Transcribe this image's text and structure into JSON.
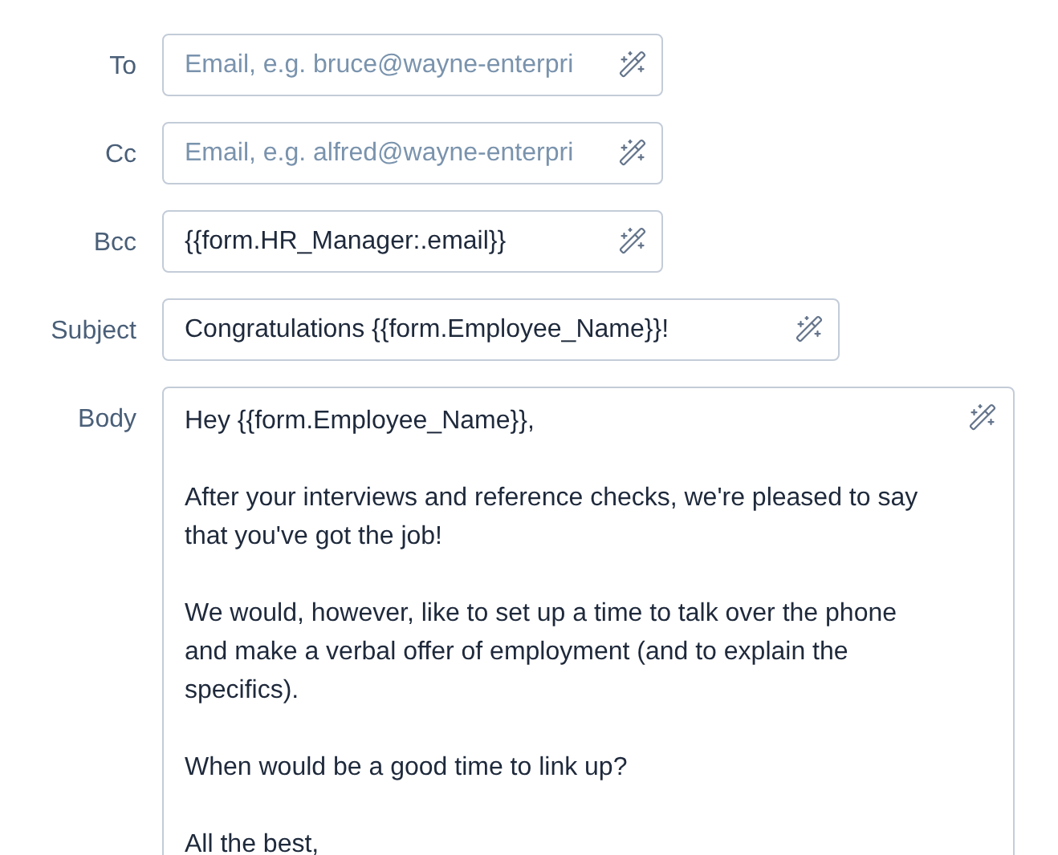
{
  "fields": [
    {
      "kind": "line",
      "label": "To",
      "placeholder": "Email, e.g. bruce@wayne-enterpri",
      "wide": false
    },
    {
      "kind": "line",
      "label": "Cc",
      "placeholder": "Email, e.g. alfred@wayne-enterpri",
      "wide": false
    },
    {
      "kind": "line",
      "label": "Bcc",
      "value": "{{form.HR_Manager:.email}}",
      "wide": false
    },
    {
      "kind": "line",
      "label": "Subject",
      "value": "Congratulations {{form.Employee_Name}}!",
      "wide": true
    },
    {
      "kind": "area",
      "label": "Body",
      "paragraphs": [
        "Hey {{form.Employee_Name}},",
        "After your interviews and reference checks, we're pleased to say that you've got the job!",
        "We would, however, like to set up a time to talk over the phone and make a verbal offer of employment (and to explain the specifics).",
        "When would be a good time to link up?",
        "All the best,"
      ]
    }
  ]
}
